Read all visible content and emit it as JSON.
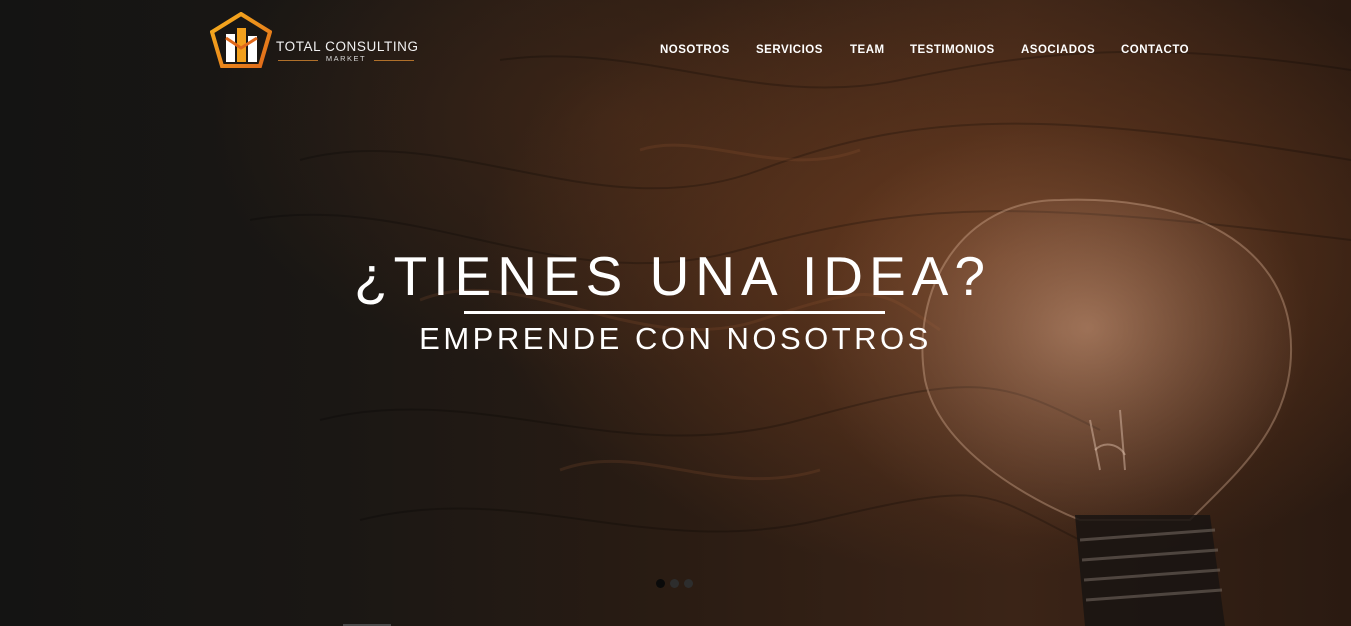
{
  "brand": {
    "name": "TOTAL CONSULTING",
    "sub": "MARKET"
  },
  "nav": {
    "items": [
      "NOSOTROS",
      "SERVICIOS",
      "TEAM",
      "TESTIMONIOS",
      "ASOCIADOS",
      "CONTACTO"
    ]
  },
  "hero": {
    "headline": "¿TIENES UNA IDEA?",
    "subline": "EMPRENDE CON NOSOTROS"
  },
  "slider": {
    "dots": 3,
    "active_index": 0
  },
  "colors": {
    "logo_gold": "#f2a01d",
    "logo_orange": "#e0681a",
    "text": "#ffffff"
  }
}
